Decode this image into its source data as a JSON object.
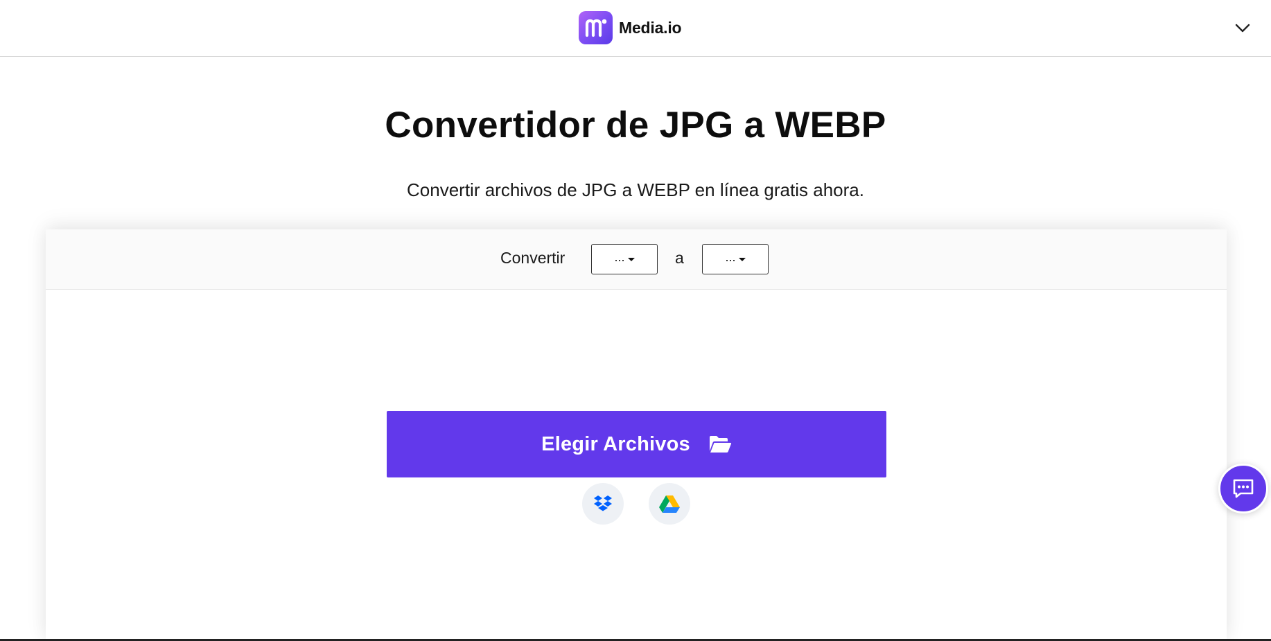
{
  "header": {
    "brand_name": "Media.io",
    "logo_icon": "media-io-logo-icon",
    "menu_icon": "chevron-down-icon"
  },
  "hero": {
    "title": "Convertidor de JPG a WEBP",
    "subtitle": "Convertir archivos de JPG a WEBP en línea gratis ahora."
  },
  "converter": {
    "convert_label": "Convertir",
    "from_value": "...",
    "to_label": "a",
    "to_value": "...",
    "choose_button_label": "Elegir Archivos",
    "choose_button_icon": "folder-open-icon",
    "cloud_sources": [
      "dropbox-icon",
      "google-drive-icon"
    ]
  },
  "chat": {
    "icon": "chat-icon"
  },
  "colors": {
    "accent": "#6239eb",
    "brand_gradient_start": "#b063f7",
    "brand_gradient_end": "#5b3be8",
    "cloud_button_bg": "#eef1f5",
    "convert_bar_bg": "#fafafa"
  }
}
